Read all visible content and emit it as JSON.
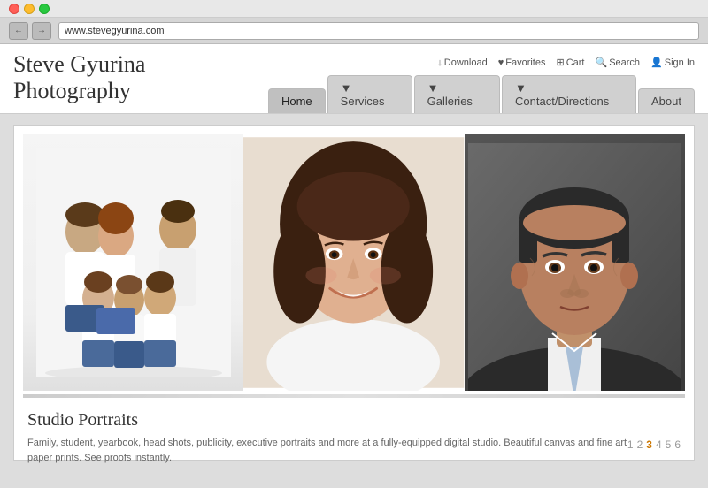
{
  "browser": {
    "address": "www.stevegyurina.com"
  },
  "site": {
    "title": "Steve Gyurina Photography",
    "utility_nav": [
      {
        "label": "Download",
        "icon": "↓"
      },
      {
        "label": "Favorites",
        "icon": "♥"
      },
      {
        "label": "Cart",
        "icon": "🛒"
      },
      {
        "label": "Search",
        "icon": "🔍"
      },
      {
        "label": "Sign In",
        "icon": "👤"
      }
    ],
    "main_nav": [
      {
        "label": "Home",
        "active": true
      },
      {
        "label": "▾ Services",
        "active": false
      },
      {
        "label": "▾ Galleries",
        "active": false
      },
      {
        "label": "▾ Contact/Directions",
        "active": false
      },
      {
        "label": "About",
        "active": false
      }
    ]
  },
  "gallery": {
    "slide_title": "Studio Portraits",
    "slide_description": "Family, student, yearbook, head shots, publicity, executive portraits and more at a fully-equipped digital studio. Beautiful canvas and fine art paper prints. See proofs instantly.",
    "pagination": [
      "1",
      "2",
      "3",
      "4",
      "5",
      "6"
    ],
    "active_page": "3"
  },
  "colors": {
    "accent": "#cc7700",
    "nav_bg": "#c8c8c8",
    "active_nav": "#b8b8b8"
  }
}
